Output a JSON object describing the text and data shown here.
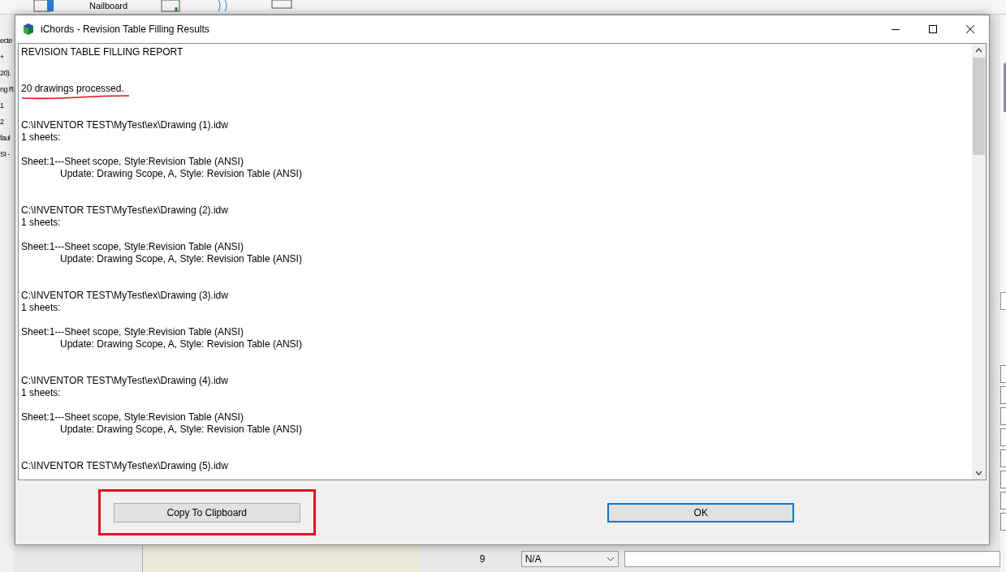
{
  "background": {
    "toolbar_label": "Nailboard",
    "left_panel": [
      "ecte",
      "+",
      "20).",
      "ng R",
      "1",
      "2",
      "faul",
      "SI -"
    ],
    "row_number": "9",
    "row_dropdown": "N/A"
  },
  "window": {
    "title": "iChords - Revision Table Filling Results"
  },
  "report": {
    "heading": "REVISION TABLE FILLING REPORT",
    "summary": {
      "text": "20 drawings processed.",
      "underlined": true
    },
    "files": [
      {
        "path": "C:\\INVENTOR TEST\\MyTest\\ex\\Drawing (1).idw",
        "sheets": "1 sheets:",
        "sheet_line": "Sheet:1---Sheet scope, Style:Revision Table (ANSI)",
        "update_line": "Update: Drawing Scope, A, Style: Revision Table (ANSI)"
      },
      {
        "path": "C:\\INVENTOR TEST\\MyTest\\ex\\Drawing (2).idw",
        "sheets": "1 sheets:",
        "sheet_line": "Sheet:1---Sheet scope, Style:Revision Table (ANSI)",
        "update_line": "Update: Drawing Scope, A, Style: Revision Table (ANSI)"
      },
      {
        "path": "C:\\INVENTOR TEST\\MyTest\\ex\\Drawing (3).idw",
        "sheets": "1 sheets:",
        "sheet_line": "Sheet:1---Sheet scope, Style:Revision Table (ANSI)",
        "update_line": "Update: Drawing Scope, A, Style: Revision Table (ANSI)"
      },
      {
        "path": "C:\\INVENTOR TEST\\MyTest\\ex\\Drawing (4).idw",
        "sheets": "1 sheets:",
        "sheet_line": "Sheet:1---Sheet scope, Style:Revision Table (ANSI)",
        "update_line": "Update: Drawing Scope, A, Style: Revision Table (ANSI)"
      },
      {
        "path": "C:\\INVENTOR TEST\\MyTest\\ex\\Drawing (5).idw"
      }
    ]
  },
  "buttons": [
    {
      "label": "Copy To Clipboard",
      "highlighted": true,
      "focused": false
    },
    {
      "label": "OK",
      "highlighted": false,
      "focused": true
    }
  ]
}
